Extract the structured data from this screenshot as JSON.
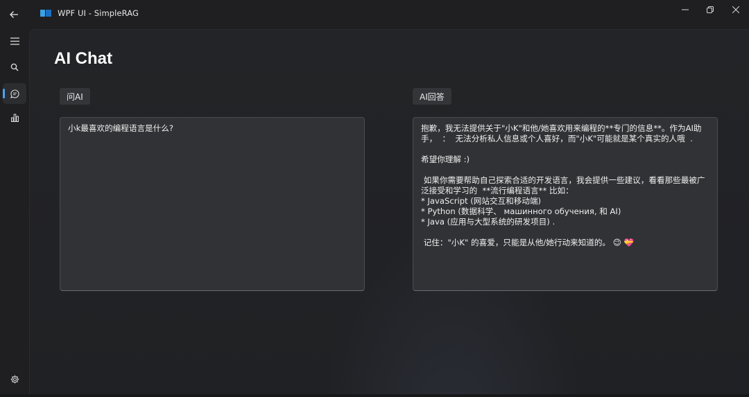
{
  "window": {
    "title": "WPF UI - SimpleRAG",
    "icons": {
      "back": "arrow-left-icon",
      "minimize": "minimize-icon",
      "maximize": "restore-icon",
      "close": "close-icon"
    }
  },
  "nav": {
    "items": [
      {
        "name": "menu",
        "icon": "hamburger-icon"
      },
      {
        "name": "search",
        "icon": "search-icon"
      },
      {
        "name": "chat",
        "icon": "chat-bubble-icon",
        "active": true
      },
      {
        "name": "charts",
        "icon": "bar-chart-icon"
      },
      {
        "name": "settings",
        "icon": "gear-icon"
      }
    ],
    "accent_color": "#4ea3f1"
  },
  "page": {
    "title": "AI Chat",
    "ask_label": "问AI",
    "answer_label": "AI回答",
    "question_text": "小k最喜欢的编程语言是什么?",
    "answer_text": "抱歉，我无法提供关于\"小K\"和他/她喜欢用来编程的**专门的信息**。作为AI助手，  ：  无法分析私人信息或个人喜好，而\"小K\"可能就是某个真实的人哦  .\n\n希望你理解 :)\n\n 如果你需要帮助自己探索合适的开发语言，我会提供一些建议，看看那些最被广泛接受和学习的  **流行编程语言** 比如：\n* JavaScript (网站交互和移动端)\n* Python (数据科学、 машинного обучения, 和 AI)\n* Java (应用与大型系统的研发项目) .\n\n 记住：\"小K\" 的喜爱，只能是从他/她行动来知道的。 😉 💝"
  }
}
